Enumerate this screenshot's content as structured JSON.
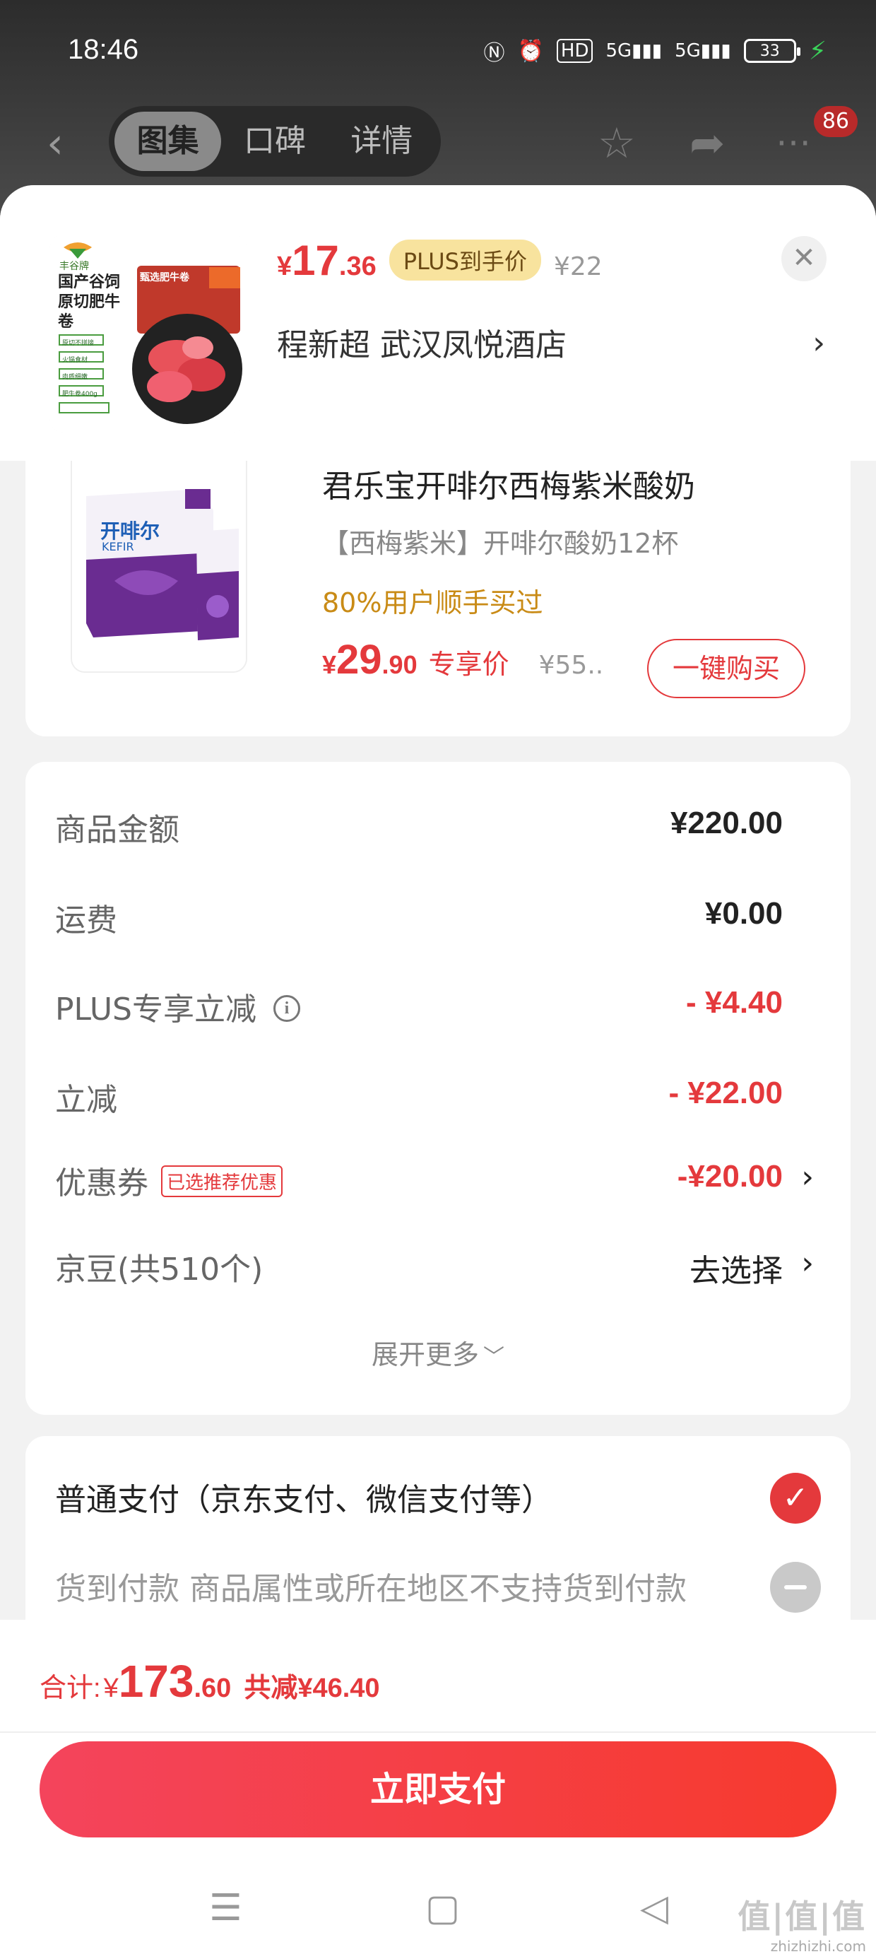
{
  "status_bar": {
    "time": "18:46",
    "battery": "33"
  },
  "nav": {
    "tabs": [
      "图集",
      "口碑",
      "详情"
    ],
    "badge": "86"
  },
  "product": {
    "price_yen": "¥",
    "price_int": "17",
    "price_dec": ".36",
    "plus_tag": "PLUS到手价",
    "orig_price": "¥22",
    "address": "程新超  武汉凤悦酒店",
    "thumb_brand": "丰谷牌",
    "thumb_title": "国产谷饲原切肥牛卷",
    "thumb_badge": "甄选肥牛卷",
    "thumb_tags": [
      "原切不拼接",
      "火锅食材",
      "肉质细嫩",
      "肥牛卷400g"
    ]
  },
  "recommend": {
    "title": "君乐宝开啡尔西梅紫米酸奶",
    "subtitle": "【西梅紫米】开啡尔酸奶12杯",
    "hint": "80%用户顺手买过",
    "price_yen": "¥",
    "price_int": "29",
    "price_dec": ".90",
    "exclusive": "专享价",
    "orig_price": "¥55..",
    "buy_label": "一键购买",
    "thumb_brand": "开啡尔",
    "thumb_sub": "KEFIR"
  },
  "amounts": {
    "rows": [
      {
        "label": "商品金额",
        "value": "¥220.00"
      },
      {
        "label": "运费",
        "value": "¥0.00"
      },
      {
        "label": "PLUS专享立减",
        "value": "- ¥4.40"
      },
      {
        "label": "立减",
        "value": "- ¥22.00"
      },
      {
        "label": "优惠券",
        "tag": "已选推荐优惠",
        "value": "-¥20.00"
      },
      {
        "label": "京豆(共510个)",
        "value": "去选择"
      }
    ],
    "expand_label": "展开更多"
  },
  "payment": {
    "option1": "普通支付（京东支付、微信支付等）",
    "option2": "货到付款 商品属性或所在地区不支持货到付款"
  },
  "footer": {
    "total_label": "合计:",
    "total_yen": "¥",
    "total_int": "173",
    "total_dec": ".60",
    "total_save": "共减¥46.40",
    "pay_button": "立即支付"
  },
  "watermark": {
    "main": "值|值|值",
    "sub": "zhizhizhi.com"
  },
  "colors": {
    "accent": "#e4393c",
    "plus_gold": "#f8e39e",
    "hint": "#c98b16"
  }
}
